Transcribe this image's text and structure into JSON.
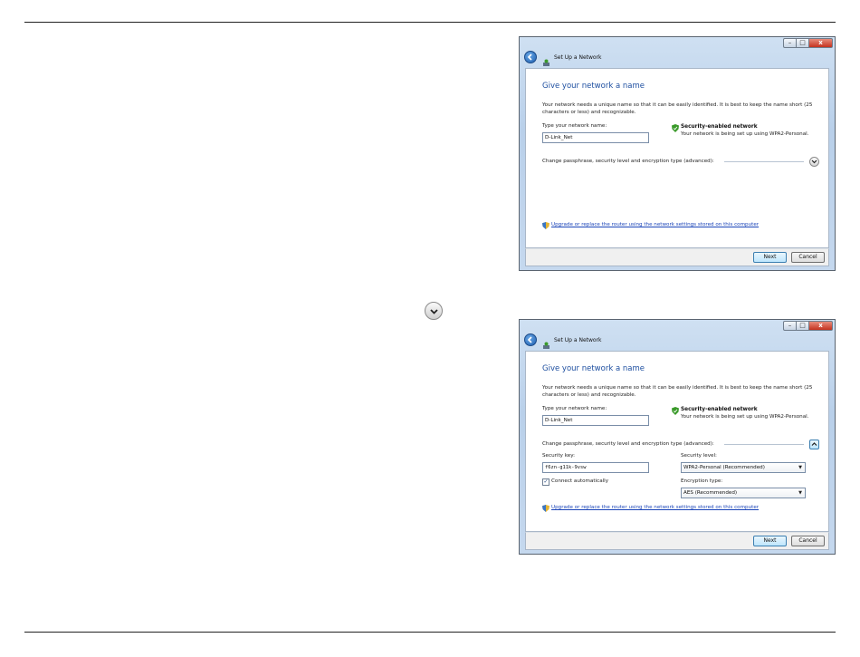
{
  "window_title": "Set Up a Network",
  "window_controls": {
    "minimize": "–",
    "maximize": "□",
    "close": "x"
  },
  "heading": "Give your network a name",
  "description": "Your network needs a unique name so that it can be easily identified. It is best to keep the name short (25 characters or less) and recognizable.",
  "network_name": {
    "label": "Type your network name:",
    "value": "D-Link_Net"
  },
  "security": {
    "title": "Security-enabled network",
    "desc": "Your network is being set up using WPA2-Personal."
  },
  "change_label": "Change passphrase, security level and encryption type (advanced):",
  "upgrade_link": "Upgrade or replace the router using the network settings stored on this computer",
  "advanced": {
    "security_key_label": "Security key:",
    "security_key_value": "f6zn-g11k-9vsw",
    "connect_label": "Connect automatically",
    "connect_checked": true,
    "security_level_label": "Security level:",
    "security_level_value": "WPA2-Personal (Recommended)",
    "encryption_label": "Encryption type:",
    "encryption_value": "AES (Recommended)"
  },
  "buttons": {
    "next": "Next",
    "cancel": "Cancel"
  },
  "icons": {
    "expand": "chevron-down-icon",
    "collapse": "chevron-up-icon",
    "back": "back-arrow-icon",
    "shield": "shield-icon"
  },
  "colors": {
    "heading": "#1e4fa0",
    "link": "#1a44b8",
    "shield_green": "#3a9a2a"
  }
}
